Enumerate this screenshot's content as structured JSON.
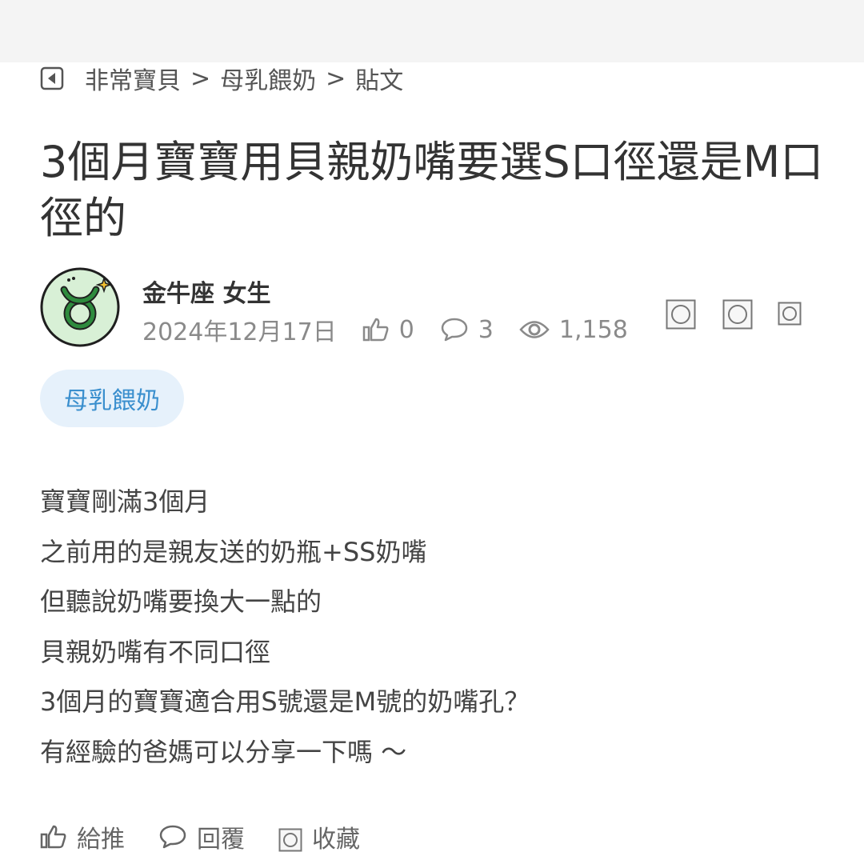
{
  "breadcrumb": {
    "items": [
      "非常寶貝",
      "母乳餵奶",
      "貼文"
    ],
    "separator": ">"
  },
  "post": {
    "title": "3個月寶寶用貝親奶嘴要選S口徑還是M口徑的",
    "author": "金牛座 女生",
    "date": "2024年12月17日",
    "likes": "0",
    "comments": "3",
    "views": "1,158",
    "tag": "母乳餵奶",
    "body_lines": [
      "寶寶剛滿3個月",
      "之前用的是親友送的奶瓶+SS奶嘴",
      "但聽說奶嘴要換大一點的",
      "貝親奶嘴有不同口徑",
      "3個月的寶寶適合用S號還是M號的奶嘴孔？",
      "有經驗的爸媽可以分享一下嗎 ～"
    ]
  },
  "actions": {
    "like_label": "給推",
    "reply_label": "回覆",
    "save_label": "收藏"
  },
  "icons": {
    "back": "back-arrow-icon",
    "avatar": "taurus-sign-icon",
    "like": "thumbs-up-icon",
    "comment": "comment-bubble-icon",
    "views": "eye-icon",
    "share": [
      "share-icon-1",
      "share-icon-2",
      "share-icon-3"
    ],
    "save": "bookmark-icon"
  },
  "colors": {
    "tag_bg": "#e6f1fb",
    "tag_text": "#3a8fce",
    "avatar_bg": "#d8f0d6",
    "avatar_symbol": "#2e8b3e"
  }
}
